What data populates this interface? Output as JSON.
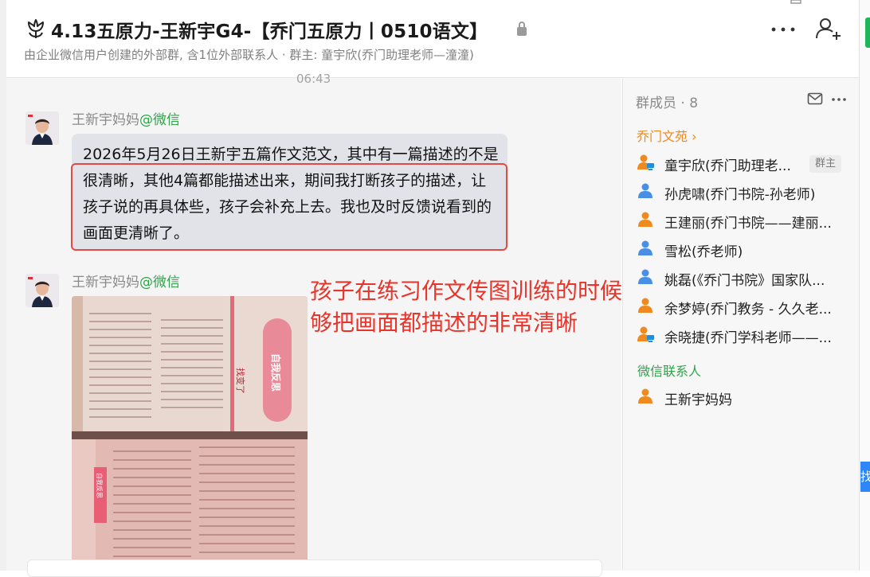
{
  "header": {
    "title": "4.13五原力-王新宇G4-【乔门五原力丨0510语文】",
    "subtitle": "由企业微信用户创建的外部群, 含1位外部联系人 · 群主: 童宇欣(乔门助理老师—潼潼)"
  },
  "chat": {
    "timestamp": "06:43",
    "messages": [
      {
        "sender": "王新宇妈妈",
        "source": "@微信",
        "text": "2026年5月26日王新宇五篇作文范文，其中有一篇描述的不是很清晰，其他4篇都能描述出来，期间我打断孩子的描述，让孩子说的再具体些，孩子会补充上去。我也及时反馈说看到的画面更清晰了。"
      },
      {
        "sender": "王新宇妈妈",
        "source": "@微信",
        "photo": {
          "left_heading": "找变了",
          "seal": "自我反思",
          "lower_tag": "自我反思"
        }
      }
    ],
    "annotation": "孩子在练习作文传图训练的时候能够把画面都描述的非常清晰"
  },
  "panel": {
    "members_title": "群成员 · 8",
    "section_qiaomen": "乔门文苑 ›",
    "members": [
      {
        "name": "童宇欣(乔门助理老...",
        "badge": "群主",
        "color": "#ee8a1f"
      },
      {
        "name": "孙虎啸(乔门书院-孙老师)",
        "color": "#4a8fe6"
      },
      {
        "name": "王建丽(乔门书院——建丽...",
        "color": "#ee8a1f"
      },
      {
        "name": "雪松(乔老师)",
        "color": "#4a8fe6"
      },
      {
        "name": "姚磊(《乔门书院》国家队...",
        "color": "#4a8fe6"
      },
      {
        "name": "余梦婷(乔门教务 - 久久老...",
        "color": "#ee8a1f"
      },
      {
        "name": "余晓捷(乔门学科老师——...",
        "color": "#ee8a1f"
      }
    ],
    "section_wechat": "微信联系人",
    "wechat_members": [
      {
        "name": "王新宇妈妈",
        "color": "#ee8a1f"
      }
    ]
  },
  "edge": {
    "blue_tab_text": "找"
  }
}
